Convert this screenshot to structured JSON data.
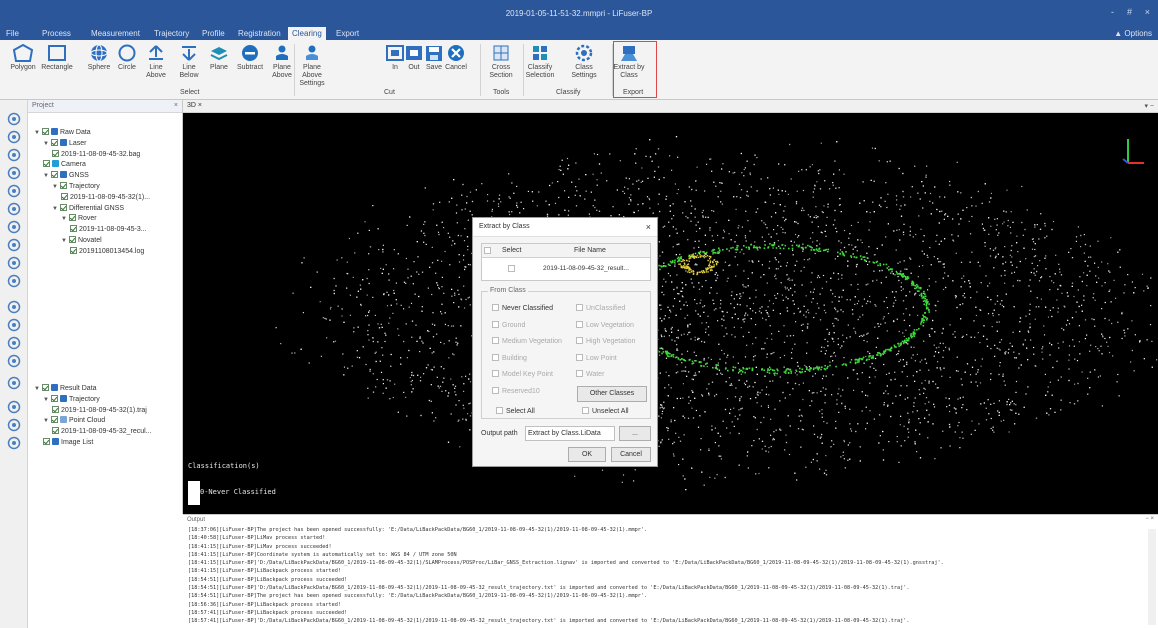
{
  "window": {
    "title": "2019-01-05-11-51-32.mmpri - LiFuser-BP",
    "controls": [
      "-",
      "#",
      "×"
    ]
  },
  "menu": {
    "items": [
      "File",
      "Process",
      "Measurement",
      "Trajectory",
      "Profile",
      "Registration",
      "Clearing",
      "Export"
    ],
    "active": "Clearing",
    "options_label": "Options"
  },
  "ribbon": {
    "select_buttons": [
      {
        "l1": "Polygon",
        "l2": ""
      },
      {
        "l1": "Rectangle",
        "l2": ""
      },
      {
        "l1": "Sphere",
        "l2": ""
      },
      {
        "l1": "Circle",
        "l2": ""
      },
      {
        "l1": "Line",
        "l2": "Above"
      },
      {
        "l1": "Line",
        "l2": "Below"
      },
      {
        "l1": "Plane",
        "l2": ""
      },
      {
        "l1": "Subtract",
        "l2": ""
      },
      {
        "l1": "Plane",
        "l2": "Above"
      },
      {
        "l1": "Plane Above",
        "l2": "Settings"
      }
    ],
    "cut_buttons": [
      {
        "l1": "In",
        "l2": ""
      },
      {
        "l1": "Out",
        "l2": ""
      },
      {
        "l1": "Save",
        "l2": ""
      },
      {
        "l1": "Cancel",
        "l2": ""
      }
    ],
    "tools_buttons": [
      {
        "l1": "Cross",
        "l2": "Section"
      }
    ],
    "classify_buttons": [
      {
        "l1": "Classify",
        "l2": "Selection"
      },
      {
        "l1": "Class",
        "l2": "Settings"
      }
    ],
    "export_buttons": [
      {
        "l1": "Extract by",
        "l2": "Class"
      }
    ],
    "groups": {
      "select": "Select",
      "cut": "Cut",
      "tools": "Tools",
      "classify": "Classify",
      "export": "Export"
    }
  },
  "project": {
    "title": "Project",
    "close": "×",
    "tree1": [
      {
        "label": "Raw Data",
        "depth": 0,
        "arrow": "▼",
        "icon": "db"
      },
      {
        "label": "Laser",
        "depth": 1,
        "arrow": "▼",
        "icon": "laser"
      },
      {
        "label": "2019-11-08-09-45-32.bag",
        "depth": 2,
        "arrow": "",
        "icon": ""
      },
      {
        "label": "Camera",
        "depth": 1,
        "arrow": "",
        "icon": "cam"
      },
      {
        "label": "GNSS",
        "depth": 1,
        "arrow": "▼",
        "icon": "gnss"
      },
      {
        "label": "Trajectory",
        "depth": 2,
        "arrow": "▼",
        "icon": ""
      },
      {
        "label": "2019-11-08-09-45-32(1)...",
        "depth": 3,
        "arrow": "",
        "icon": ""
      },
      {
        "label": "Differential GNSS",
        "depth": 2,
        "arrow": "▼",
        "icon": ""
      },
      {
        "label": "Rover",
        "depth": 3,
        "arrow": "▼",
        "icon": ""
      },
      {
        "label": "2019-11-08-09-45-3...",
        "depth": 4,
        "arrow": "",
        "icon": ""
      },
      {
        "label": "Novatel",
        "depth": 3,
        "arrow": "▼",
        "icon": ""
      },
      {
        "label": "20191108013454.log",
        "depth": 4,
        "arrow": "",
        "icon": ""
      }
    ],
    "tree2": [
      {
        "label": "Result Data",
        "depth": 0,
        "arrow": "▼",
        "icon": "db"
      },
      {
        "label": "Trajectory",
        "depth": 1,
        "arrow": "▼",
        "icon": "traj"
      },
      {
        "label": "2019-11-08-09-45-32(1).traj",
        "depth": 2,
        "arrow": "",
        "icon": ""
      },
      {
        "label": "Point Cloud",
        "depth": 1,
        "arrow": "▼",
        "icon": "pc"
      },
      {
        "label": "2019-11-08-09-45-32_recul...",
        "depth": 2,
        "arrow": "",
        "icon": ""
      },
      {
        "label": "Image List",
        "depth": 1,
        "arrow": "",
        "icon": "img"
      }
    ]
  },
  "view": {
    "tab": "3D",
    "legend_title": "Classification(s)",
    "legend_item": "0-Never Classified"
  },
  "dialog": {
    "title": "Extract by Class",
    "close": "×",
    "col_select": "Select",
    "col_file": "File Name",
    "file": "2019-11-08-09-45-32_result...",
    "from_class": "From Class",
    "classes": [
      {
        "l": "Never Classified",
        "on": true
      },
      {
        "l": "UnClassified",
        "on": false
      },
      {
        "l": "Ground",
        "on": false
      },
      {
        "l": "Low Vegetation",
        "on": false
      },
      {
        "l": "Medium Vegetation",
        "on": false
      },
      {
        "l": "High Vegetation",
        "on": false
      },
      {
        "l": "Building",
        "on": false
      },
      {
        "l": "Low Point",
        "on": false
      },
      {
        "l": "Model Key Point",
        "on": false
      },
      {
        "l": "Water",
        "on": false
      },
      {
        "l": "Reserved10",
        "on": false
      }
    ],
    "other_classes": "Other Classes",
    "select_all": "Select All",
    "unselect_all": "Unselect All",
    "output_label": "Output path",
    "output_value": "Extract by Class.LiData",
    "browse": "...",
    "ok": "OK",
    "cancel": "Cancel"
  },
  "output": {
    "title": "Output",
    "pin": "− ×",
    "lines": [
      "[18:37:06][LiFuser-BP]The project has been opened successfully: 'E:/Data/LiBackPackData/BG60_1/2019-11-08-09-45-32(1)/2019-11-08-09-45-32(1).mmpr'.",
      "[18:40:58][LiFuser-BP]LiMav process started!",
      "[18:41:15][LiFuser-BP]LiMav process succeeded!",
      "[18:41:15][LiFuser-BP]Coordinate system is automatically set to: WGS 84 / UTM zone 50N",
      "[18:41:15][LiFuser-BP]'D:/Data/LiBackPackData/BG60_1/2019-11-08-09-45-32(1)/SLAMProcess/POSProc/LiBar_GNSS_Extraction.lignav' is imported and converted to 'E:/Data/LiBackPackData/BG60_1/2019-11-08-09-45-32(1)/2019-11-08-09-45-32(1).gnsstraj'.",
      "[18:41:15][LiFuser-BP]LiBackpack process started!",
      "[18:54:51][LiFuser-BP]LiBackpack process succeeded!",
      "[18:54:51][LiFuser-BP]'D:/Data/LiBackPackData/BG60_1/2019-11-08-09-45-32(1)/2019-11-08-09-45-32_result_trajectory.txt' is imported and converted to 'E:/Data/LiBackPackData/BG60_1/2019-11-08-09-45-32(1)/2019-11-08-09-45-32(1).traj'.",
      "[18:54:51][LiFuser-BP]The project has been opened successfully: 'E:/Data/LiBackPackData/BG60_1/2019-11-08-09-45-32(1)/2019-11-08-09-45-32(1).mmpr'.",
      "[18:56:36][LiFuser-BP]LiBackpack process started!",
      "[18:57:41][LiFuser-BP]LiBackpack process succeeded!",
      "[18:57:41][LiFuser-BP]'D:/Data/LiBackPackData/BG60_1/2019-11-08-09-45-32(1)/2019-11-08-09-45-32_result_trajectory.txt' is imported and converted to 'E:/Data/LiBackPackData/BG60_1/2019-11-08-09-45-32(1)/2019-11-08-09-45-32(1).traj'."
    ]
  }
}
